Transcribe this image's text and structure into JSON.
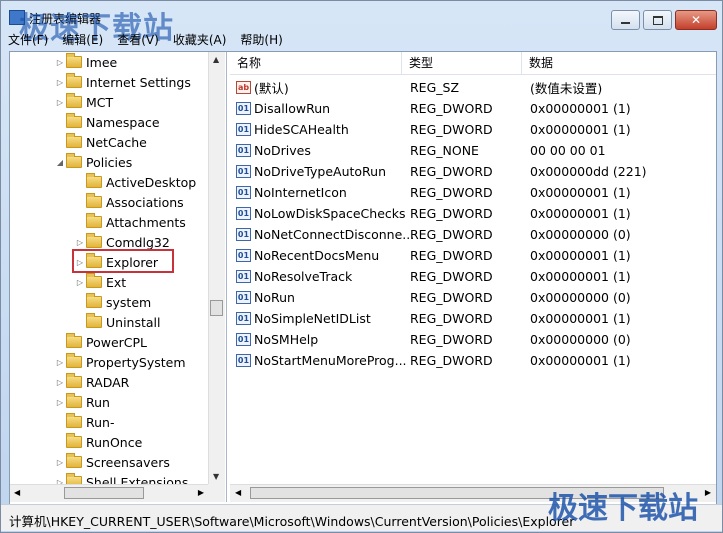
{
  "window": {
    "title": "注册表编辑器",
    "watermark": "极速下载站",
    "minimize_label": "",
    "maximize_label": "",
    "close_label": "✕"
  },
  "menu": {
    "items": [
      "文件(F)",
      "编辑(E)",
      "查看(V)",
      "收藏夹(A)",
      "帮助(H)"
    ]
  },
  "tree": {
    "items": [
      {
        "label": "Imee",
        "indent": 0,
        "expanded": false
      },
      {
        "label": "Internet Settings",
        "indent": 0,
        "expanded": false
      },
      {
        "label": "MCT",
        "indent": 0,
        "expanded": false
      },
      {
        "label": "Namespace",
        "indent": 0,
        "expanded": null
      },
      {
        "label": "NetCache",
        "indent": 0,
        "expanded": null
      },
      {
        "label": "Policies",
        "indent": 0,
        "expanded": true
      },
      {
        "label": "ActiveDesktop",
        "indent": 1,
        "expanded": null
      },
      {
        "label": "Associations",
        "indent": 1,
        "expanded": null
      },
      {
        "label": "Attachments",
        "indent": 1,
        "expanded": null
      },
      {
        "label": "Comdlg32",
        "indent": 1,
        "expanded": false
      },
      {
        "label": "Explorer",
        "indent": 1,
        "expanded": false,
        "selected": true
      },
      {
        "label": "Ext",
        "indent": 1,
        "expanded": false
      },
      {
        "label": "system",
        "indent": 1,
        "expanded": null
      },
      {
        "label": "Uninstall",
        "indent": 1,
        "expanded": null
      },
      {
        "label": "PowerCPL",
        "indent": 0,
        "expanded": null
      },
      {
        "label": "PropertySystem",
        "indent": 0,
        "expanded": false
      },
      {
        "label": "RADAR",
        "indent": 0,
        "expanded": false
      },
      {
        "label": "Run",
        "indent": 0,
        "expanded": false
      },
      {
        "label": "Run-",
        "indent": 0,
        "expanded": null
      },
      {
        "label": "RunOnce",
        "indent": 0,
        "expanded": null
      },
      {
        "label": "Screensavers",
        "indent": 0,
        "expanded": false
      },
      {
        "label": "Shell Extensions",
        "indent": 0,
        "expanded": false
      }
    ]
  },
  "list": {
    "columns": [
      "名称",
      "类型",
      "数据"
    ],
    "rows": [
      {
        "name": "(默认)",
        "type": "REG_SZ",
        "data": "(数值未设置)",
        "icon": "string-value-icon"
      },
      {
        "name": "DisallowRun",
        "type": "REG_DWORD",
        "data": "0x00000001 (1)",
        "icon": "binary-value-icon"
      },
      {
        "name": "HideSCAHealth",
        "type": "REG_DWORD",
        "data": "0x00000001 (1)",
        "icon": "binary-value-icon"
      },
      {
        "name": "NoDrives",
        "type": "REG_NONE",
        "data": "00 00 00 01",
        "icon": "binary-value-icon"
      },
      {
        "name": "NoDriveTypeAutoRun",
        "type": "REG_DWORD",
        "data": "0x000000dd (221)",
        "icon": "binary-value-icon"
      },
      {
        "name": "NoInternetIcon",
        "type": "REG_DWORD",
        "data": "0x00000001 (1)",
        "icon": "binary-value-icon"
      },
      {
        "name": "NoLowDiskSpaceChecks",
        "type": "REG_DWORD",
        "data": "0x00000001 (1)",
        "icon": "binary-value-icon"
      },
      {
        "name": "NoNetConnectDisconne...",
        "type": "REG_DWORD",
        "data": "0x00000000 (0)",
        "icon": "binary-value-icon"
      },
      {
        "name": "NoRecentDocsMenu",
        "type": "REG_DWORD",
        "data": "0x00000001 (1)",
        "icon": "binary-value-icon"
      },
      {
        "name": "NoResolveTrack",
        "type": "REG_DWORD",
        "data": "0x00000001 (1)",
        "icon": "binary-value-icon"
      },
      {
        "name": "NoRun",
        "type": "REG_DWORD",
        "data": "0x00000000 (0)",
        "icon": "binary-value-icon"
      },
      {
        "name": "NoSimpleNetIDList",
        "type": "REG_DWORD",
        "data": "0x00000001 (1)",
        "icon": "binary-value-icon"
      },
      {
        "name": "NoSMHelp",
        "type": "REG_DWORD",
        "data": "0x00000000 (0)",
        "icon": "binary-value-icon"
      },
      {
        "name": "NoStartMenuMoreProg...",
        "type": "REG_DWORD",
        "data": "0x00000001 (1)",
        "icon": "binary-value-icon"
      }
    ]
  },
  "status": {
    "path": "计算机\\HKEY_CURRENT_USER\\Software\\Microsoft\\Windows\\CurrentVersion\\Policies\\Explorer"
  },
  "colors": {
    "selection_outline": "#c8323a",
    "watermark": "#124ca8"
  }
}
